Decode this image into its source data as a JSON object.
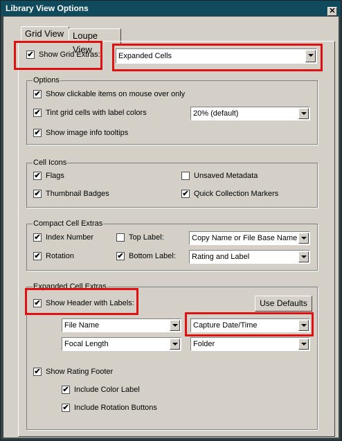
{
  "window": {
    "title": "Library View Options",
    "close_glyph": "✕"
  },
  "tabs": [
    {
      "label": "Grid View"
    },
    {
      "label": "Loupe View"
    }
  ],
  "show_grid_extras": {
    "label": "Show Grid Extras:",
    "checked": true,
    "value": "Expanded Cells"
  },
  "options": {
    "title": "Options",
    "clickable": {
      "label": "Show clickable items on mouse over only",
      "checked": true
    },
    "tint": {
      "label": "Tint grid cells with label colors",
      "checked": true,
      "value": "20% (default)"
    },
    "tooltips": {
      "label": "Show image info tooltips",
      "checked": true
    }
  },
  "cell_icons": {
    "title": "Cell Icons",
    "flags": {
      "label": "Flags",
      "checked": true
    },
    "unsaved": {
      "label": "Unsaved Metadata",
      "checked": false
    },
    "thumb": {
      "label": "Thumbnail Badges",
      "checked": true
    },
    "quick": {
      "label": "Quick Collection Markers",
      "checked": true
    }
  },
  "compact": {
    "title": "Compact Cell Extras",
    "index": {
      "label": "Index Number",
      "checked": true
    },
    "top": {
      "label": "Top Label:",
      "checked": false,
      "value": "Copy Name or File Base Name"
    },
    "rotation": {
      "label": "Rotation",
      "checked": true
    },
    "bottom": {
      "label": "Bottom Label:",
      "checked": true,
      "value": "Rating and Label"
    }
  },
  "expanded": {
    "title": "Expanded Cell Extras",
    "header": {
      "label": "Show Header with Labels:",
      "checked": true
    },
    "use_defaults": "Use Defaults",
    "fields": [
      "File Name",
      "Capture Date/Time",
      "Focal Length",
      "Folder"
    ],
    "rating_footer": {
      "label": "Show Rating Footer",
      "checked": true
    },
    "color_label": {
      "label": "Include Color Label",
      "checked": true
    },
    "rotation_buttons": {
      "label": "Include Rotation Buttons",
      "checked": true
    }
  },
  "check_glyph": "✔"
}
